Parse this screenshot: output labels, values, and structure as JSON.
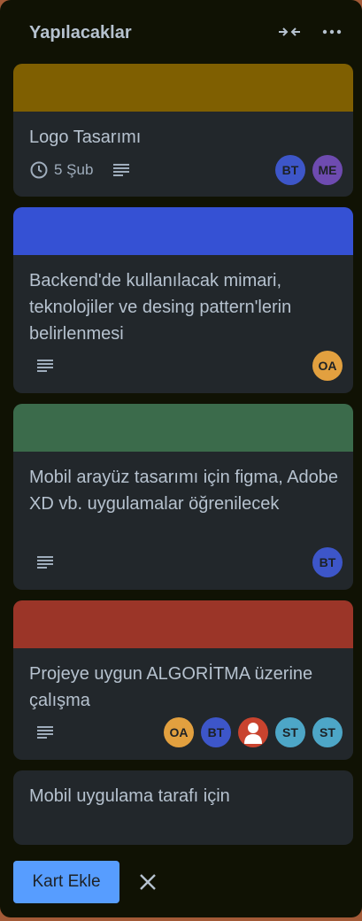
{
  "list": {
    "title": "Yapılacaklar",
    "header_icons": [
      "collapse-icon",
      "more-icon"
    ]
  },
  "cards": [
    {
      "cover_color": "#7f5f01",
      "title": "Logo Tasarımı",
      "due": "5 Şub",
      "has_description": true,
      "members": [
        {
          "initials": "BT",
          "color": "#3d56c9"
        },
        {
          "initials": "ME",
          "color": "#6e4bb0"
        }
      ]
    },
    {
      "cover_color": "#3551d4",
      "title": "Backend'de kullanılacak mimari, teknolojiler ve desing pattern'lerin belirlenmesi",
      "has_description": true,
      "members": [
        {
          "initials": "OA",
          "color": "#e2a03f"
        }
      ]
    },
    {
      "cover_color": "#3b6b4b",
      "title": "Mobil arayüz tasarımı için figma, Adobe XD vb. uygulamalar öğrenilecek",
      "has_description": true,
      "members": [
        {
          "initials": "BT",
          "color": "#3d56c9"
        }
      ]
    },
    {
      "cover_color": "#9b3528",
      "title": "Projeye uygun ALGORİTMA üzerine çalışma",
      "has_description": true,
      "members": [
        {
          "initials": "OA",
          "color": "#e2a03f"
        },
        {
          "initials": "BT",
          "color": "#3d56c9"
        },
        {
          "initials": "",
          "color": "#c9432e",
          "icon": "person-icon"
        },
        {
          "initials": "ST",
          "color": "#4da6c7"
        },
        {
          "initials": "ST",
          "color": "#4da6c7"
        }
      ]
    }
  ],
  "composer": {
    "value": "Mobil uygulama tarafı için"
  },
  "footer": {
    "add_label": "Kart Ekle",
    "close_icon": "close-icon"
  }
}
